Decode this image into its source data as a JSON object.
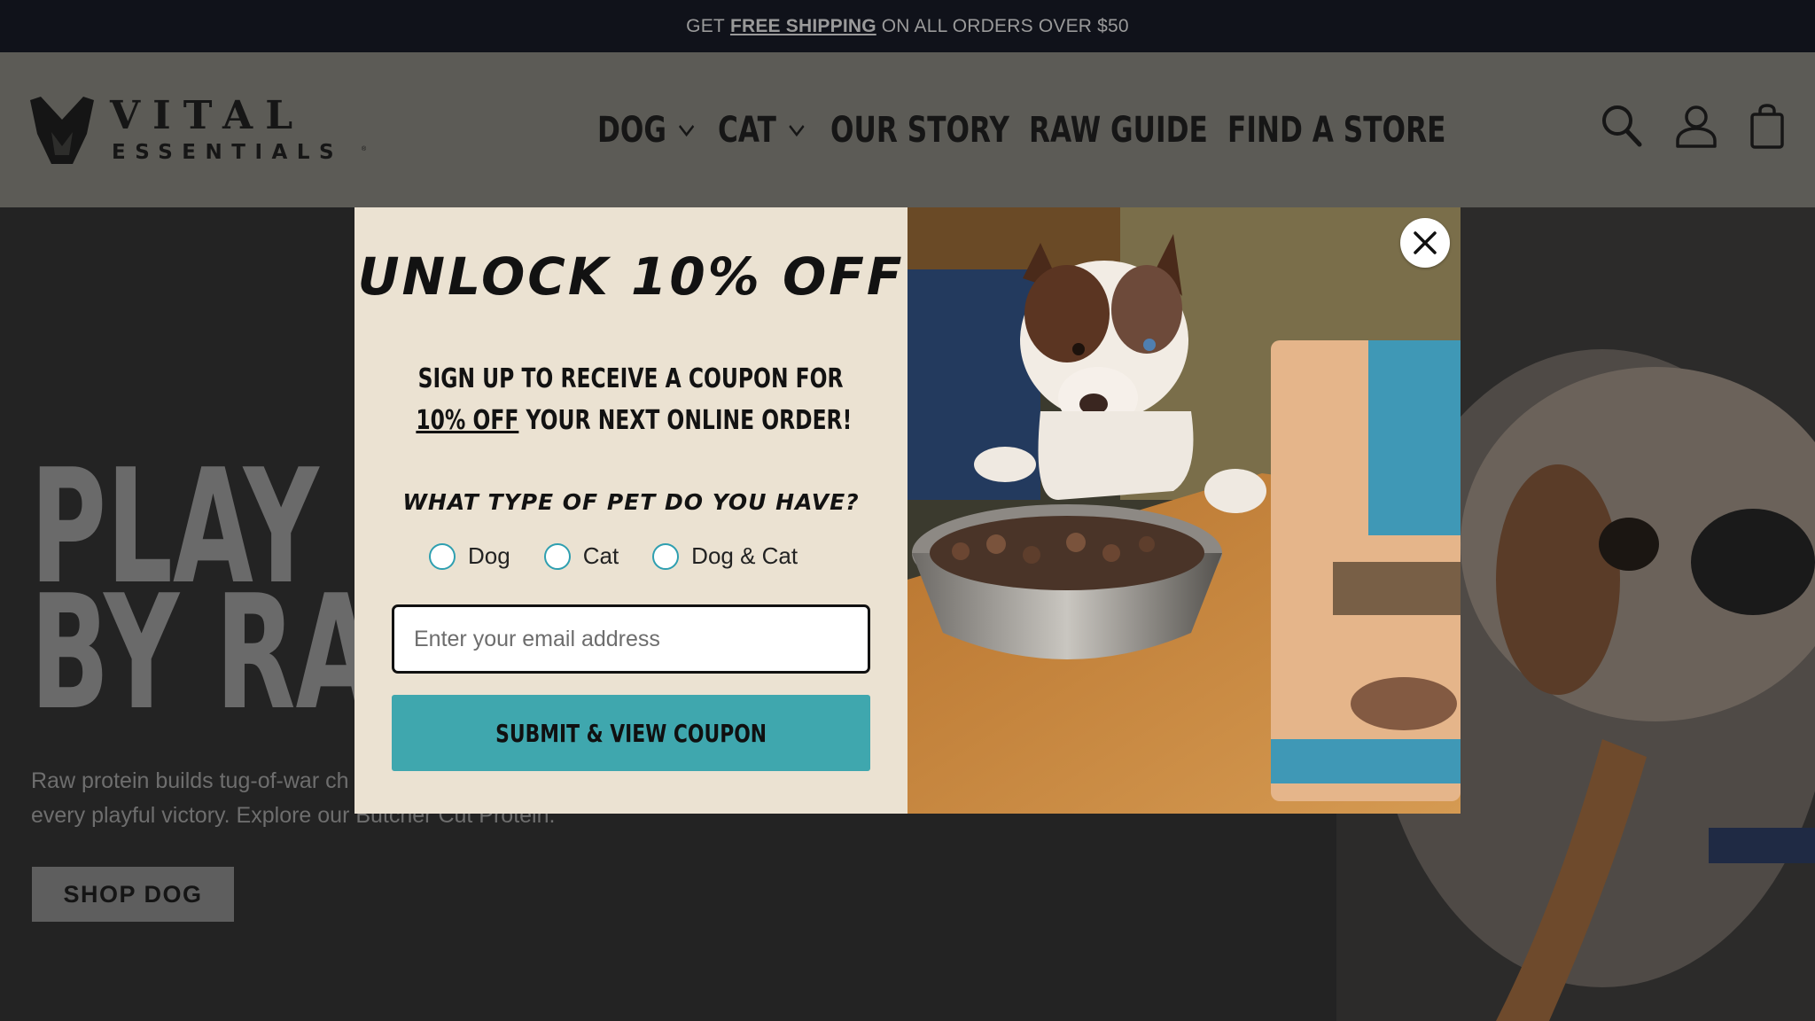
{
  "announcement": {
    "prefix": "GET",
    "link": "FREE SHIPPING",
    "suffix": "ON ALL ORDERS OVER $50"
  },
  "header": {
    "logo": {
      "line1": "VITAL",
      "line2": "ESSENTIALS",
      "tm": "®"
    },
    "nav": [
      {
        "label": "DOG",
        "has_dropdown": true
      },
      {
        "label": "CAT",
        "has_dropdown": true
      },
      {
        "label": "OUR STORY",
        "has_dropdown": false
      },
      {
        "label": "RAW GUIDE",
        "has_dropdown": false
      },
      {
        "label": "FIND A STORE",
        "has_dropdown": false
      }
    ],
    "icons": [
      "search-icon",
      "account-icon",
      "cart-icon"
    ]
  },
  "hero": {
    "title_line1": "PLAY P",
    "title_line2": "BY RAV",
    "description_line1": "Raw protein builds tug-of-war ch",
    "description_line2": "every playful victory. Explore our Butcher Cut Protein.",
    "button": "SHOP DOG"
  },
  "popup": {
    "title": "UNLOCK 10% OFF",
    "subtitle_line1": "SIGN UP TO RECEIVE A COUPON FOR",
    "subtitle_underlined": "10% OFF",
    "subtitle_line2_rest": "YOUR NEXT ONLINE ORDER!",
    "question": "WHAT TYPE OF PET DO YOU HAVE?",
    "pet_options": [
      "Dog",
      "Cat",
      "Dog & Cat"
    ],
    "email_placeholder": "Enter your email address",
    "submit_label": "SUBMIT & VIEW COUPON",
    "accent_color": "#3fa7ae",
    "panel_color": "#ebe2d2"
  }
}
